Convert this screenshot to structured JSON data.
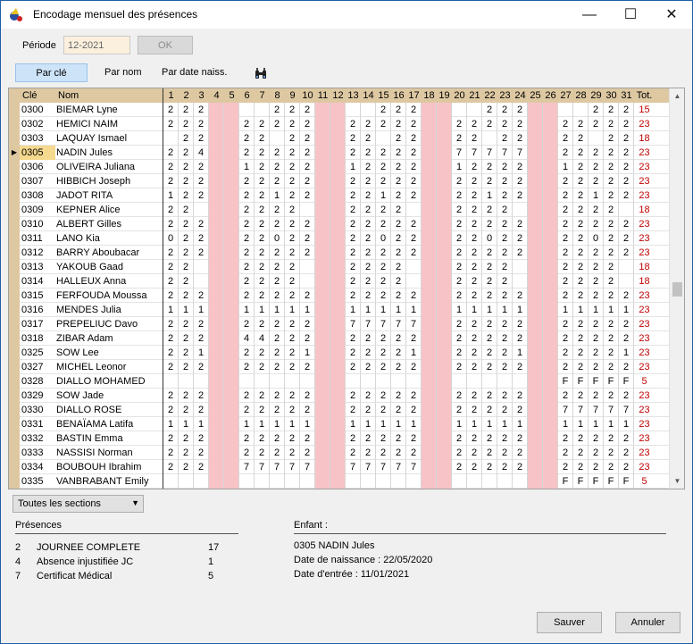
{
  "window": {
    "title": "Encodage mensuel des présences",
    "minimize": "—",
    "maximize": "☐",
    "close": "✕"
  },
  "toolbar": {
    "periode_label": "Période",
    "periode_value": "12-2021",
    "ok_label": "OK",
    "tabs": [
      "Par clé",
      "Par nom",
      "Par date naiss."
    ],
    "search_icon": "binoculars-icon"
  },
  "grid": {
    "col_cle": "Clé",
    "col_nom": "Nom",
    "col_tot": "Tot.",
    "days": [
      "1",
      "2",
      "3",
      "4",
      "5",
      "6",
      "7",
      "8",
      "9",
      "10",
      "11",
      "12",
      "13",
      "14",
      "15",
      "16",
      "17",
      "18",
      "19",
      "20",
      "21",
      "22",
      "23",
      "24",
      "25",
      "26",
      "27",
      "28",
      "29",
      "30",
      "31"
    ],
    "weekend_days": [
      4,
      5,
      11,
      12,
      18,
      19,
      25,
      26
    ],
    "selected_row": 3,
    "rows": [
      {
        "cle": "0300",
        "nom": "BIEMAR Lyne",
        "vals": {
          "1": "2",
          "2": "2",
          "3": "2",
          "8": "2",
          "9": "2",
          "10": "2",
          "15": "2",
          "16": "2",
          "17": "2",
          "22": "2",
          "23": "2",
          "24": "2",
          "29": "2",
          "30": "2",
          "31": "2"
        },
        "tot": "15"
      },
      {
        "cle": "0302",
        "nom": "HEMICI NAIM",
        "vals": {
          "1": "2",
          "2": "2",
          "3": "2",
          "6": "2",
          "7": "2",
          "8": "2",
          "9": "2",
          "10": "2",
          "13": "2",
          "14": "2",
          "15": "2",
          "16": "2",
          "17": "2",
          "20": "2",
          "21": "2",
          "22": "2",
          "23": "2",
          "24": "2",
          "27": "2",
          "28": "2",
          "29": "2",
          "30": "2",
          "31": "2"
        },
        "tot": "23"
      },
      {
        "cle": "0303",
        "nom": "LAQUAY Ismael",
        "vals": {
          "2": "2",
          "3": "2",
          "6": "2",
          "7": "2",
          "9": "2",
          "10": "2",
          "13": "2",
          "14": "2",
          "16": "2",
          "17": "2",
          "20": "2",
          "21": "2",
          "23": "2",
          "24": "2",
          "27": "2",
          "28": "2",
          "30": "2",
          "31": "2"
        },
        "tot": "18"
      },
      {
        "cle": "0305",
        "nom": "NADIN Jules",
        "vals": {
          "1": "2",
          "2": "2",
          "3": "4",
          "6": "2",
          "7": "2",
          "8": "2",
          "9": "2",
          "10": "2",
          "13": "2",
          "14": "2",
          "15": "2",
          "16": "2",
          "17": "2",
          "20": "7",
          "21": "7",
          "22": "7",
          "23": "7",
          "24": "7",
          "27": "2",
          "28": "2",
          "29": "2",
          "30": "2",
          "31": "2"
        },
        "tot": "23"
      },
      {
        "cle": "0306",
        "nom": "OLIVEIRA Juliana",
        "vals": {
          "1": "2",
          "2": "2",
          "3": "2",
          "6": "1",
          "7": "2",
          "8": "2",
          "9": "2",
          "10": "2",
          "13": "1",
          "14": "2",
          "15": "2",
          "16": "2",
          "17": "2",
          "20": "1",
          "21": "2",
          "22": "2",
          "23": "2",
          "24": "2",
          "27": "1",
          "28": "2",
          "29": "2",
          "30": "2",
          "31": "2"
        },
        "tot": "23"
      },
      {
        "cle": "0307",
        "nom": "HIBBICH Joseph",
        "vals": {
          "1": "2",
          "2": "2",
          "3": "2",
          "6": "2",
          "7": "2",
          "8": "2",
          "9": "2",
          "10": "2",
          "13": "2",
          "14": "2",
          "15": "2",
          "16": "2",
          "17": "2",
          "20": "2",
          "21": "2",
          "22": "2",
          "23": "2",
          "24": "2",
          "27": "2",
          "28": "2",
          "29": "2",
          "30": "2",
          "31": "2"
        },
        "tot": "23"
      },
      {
        "cle": "0308",
        "nom": "JADOT RITA",
        "vals": {
          "1": "1",
          "2": "2",
          "3": "2",
          "6": "2",
          "7": "2",
          "8": "1",
          "9": "2",
          "10": "2",
          "13": "2",
          "14": "2",
          "15": "1",
          "16": "2",
          "17": "2",
          "20": "2",
          "21": "2",
          "22": "1",
          "23": "2",
          "24": "2",
          "27": "2",
          "28": "2",
          "29": "1",
          "30": "2",
          "31": "2"
        },
        "tot": "23"
      },
      {
        "cle": "0309",
        "nom": "KEPNER Alice",
        "vals": {
          "1": "2",
          "2": "2",
          "6": "2",
          "7": "2",
          "8": "2",
          "9": "2",
          "13": "2",
          "14": "2",
          "15": "2",
          "16": "2",
          "20": "2",
          "21": "2",
          "22": "2",
          "23": "2",
          "27": "2",
          "28": "2",
          "29": "2",
          "30": "2"
        },
        "tot": "18"
      },
      {
        "cle": "0310",
        "nom": "ALBERT Gilles",
        "vals": {
          "1": "2",
          "2": "2",
          "3": "2",
          "6": "2",
          "7": "2",
          "8": "2",
          "9": "2",
          "10": "2",
          "13": "2",
          "14": "2",
          "15": "2",
          "16": "2",
          "17": "2",
          "20": "2",
          "21": "2",
          "22": "2",
          "23": "2",
          "24": "2",
          "27": "2",
          "28": "2",
          "29": "2",
          "30": "2",
          "31": "2"
        },
        "tot": "23"
      },
      {
        "cle": "0311",
        "nom": "LANO Kia",
        "vals": {
          "1": "0",
          "2": "2",
          "3": "2",
          "6": "2",
          "7": "2",
          "8": "0",
          "9": "2",
          "10": "2",
          "13": "2",
          "14": "2",
          "15": "0",
          "16": "2",
          "17": "2",
          "20": "2",
          "21": "2",
          "22": "0",
          "23": "2",
          "24": "2",
          "27": "2",
          "28": "2",
          "29": "0",
          "30": "2",
          "31": "2"
        },
        "tot": "23"
      },
      {
        "cle": "0312",
        "nom": "BARRY Aboubacar",
        "vals": {
          "1": "2",
          "2": "2",
          "3": "2",
          "6": "2",
          "7": "2",
          "8": "2",
          "9": "2",
          "10": "2",
          "13": "2",
          "14": "2",
          "15": "2",
          "16": "2",
          "17": "2",
          "20": "2",
          "21": "2",
          "22": "2",
          "23": "2",
          "24": "2",
          "27": "2",
          "28": "2",
          "29": "2",
          "30": "2",
          "31": "2"
        },
        "tot": "23"
      },
      {
        "cle": "0313",
        "nom": "YAKOUB Gaad",
        "vals": {
          "1": "2",
          "2": "2",
          "6": "2",
          "7": "2",
          "8": "2",
          "9": "2",
          "13": "2",
          "14": "2",
          "15": "2",
          "16": "2",
          "20": "2",
          "21": "2",
          "22": "2",
          "23": "2",
          "27": "2",
          "28": "2",
          "29": "2",
          "30": "2"
        },
        "tot": "18"
      },
      {
        "cle": "0314",
        "nom": "HALLEUX Anna",
        "vals": {
          "1": "2",
          "2": "2",
          "6": "2",
          "7": "2",
          "8": "2",
          "9": "2",
          "13": "2",
          "14": "2",
          "15": "2",
          "16": "2",
          "20": "2",
          "21": "2",
          "22": "2",
          "23": "2",
          "27": "2",
          "28": "2",
          "29": "2",
          "30": "2"
        },
        "tot": "18"
      },
      {
        "cle": "0315",
        "nom": "FERFOUDA Moussa",
        "vals": {
          "1": "2",
          "2": "2",
          "3": "2",
          "6": "2",
          "7": "2",
          "8": "2",
          "9": "2",
          "10": "2",
          "13": "2",
          "14": "2",
          "15": "2",
          "16": "2",
          "17": "2",
          "20": "2",
          "21": "2",
          "22": "2",
          "23": "2",
          "24": "2",
          "27": "2",
          "28": "2",
          "29": "2",
          "30": "2",
          "31": "2"
        },
        "tot": "23"
      },
      {
        "cle": "0316",
        "nom": "MENDES Julia",
        "vals": {
          "1": "1",
          "2": "1",
          "3": "1",
          "6": "1",
          "7": "1",
          "8": "1",
          "9": "1",
          "10": "1",
          "13": "1",
          "14": "1",
          "15": "1",
          "16": "1",
          "17": "1",
          "20": "1",
          "21": "1",
          "22": "1",
          "23": "1",
          "24": "1",
          "27": "1",
          "28": "1",
          "29": "1",
          "30": "1",
          "31": "1"
        },
        "tot": "23"
      },
      {
        "cle": "0317",
        "nom": "PREPELIUC Davo",
        "vals": {
          "1": "2",
          "2": "2",
          "3": "2",
          "6": "2",
          "7": "2",
          "8": "2",
          "9": "2",
          "10": "2",
          "13": "7",
          "14": "7",
          "15": "7",
          "16": "7",
          "17": "7",
          "20": "2",
          "21": "2",
          "22": "2",
          "23": "2",
          "24": "2",
          "27": "2",
          "28": "2",
          "29": "2",
          "30": "2",
          "31": "2"
        },
        "tot": "23"
      },
      {
        "cle": "0318",
        "nom": "ZIBAR Adam",
        "vals": {
          "1": "2",
          "2": "2",
          "3": "2",
          "6": "4",
          "7": "4",
          "8": "2",
          "9": "2",
          "10": "2",
          "13": "2",
          "14": "2",
          "15": "2",
          "16": "2",
          "17": "2",
          "20": "2",
          "21": "2",
          "22": "2",
          "23": "2",
          "24": "2",
          "27": "2",
          "28": "2",
          "29": "2",
          "30": "2",
          "31": "2"
        },
        "tot": "23"
      },
      {
        "cle": "0325",
        "nom": "SOW Lee",
        "vals": {
          "1": "2",
          "2": "2",
          "3": "1",
          "6": "2",
          "7": "2",
          "8": "2",
          "9": "2",
          "10": "1",
          "13": "2",
          "14": "2",
          "15": "2",
          "16": "2",
          "17": "1",
          "20": "2",
          "21": "2",
          "22": "2",
          "23": "2",
          "24": "1",
          "27": "2",
          "28": "2",
          "29": "2",
          "30": "2",
          "31": "1"
        },
        "tot": "23"
      },
      {
        "cle": "0327",
        "nom": "MICHEL Leonor",
        "vals": {
          "1": "2",
          "2": "2",
          "3": "2",
          "6": "2",
          "7": "2",
          "8": "2",
          "9": "2",
          "10": "2",
          "13": "2",
          "14": "2",
          "15": "2",
          "16": "2",
          "17": "2",
          "20": "2",
          "21": "2",
          "22": "2",
          "23": "2",
          "24": "2",
          "27": "2",
          "28": "2",
          "29": "2",
          "30": "2",
          "31": "2"
        },
        "tot": "23"
      },
      {
        "cle": "0328",
        "nom": "DIALLO MOHAMED",
        "vals": {
          "27": "F",
          "28": "F",
          "29": "F",
          "30": "F",
          "31": "F"
        },
        "tot": "5"
      },
      {
        "cle": "0329",
        "nom": "SOW Jade",
        "vals": {
          "1": "2",
          "2": "2",
          "3": "2",
          "6": "2",
          "7": "2",
          "8": "2",
          "9": "2",
          "10": "2",
          "13": "2",
          "14": "2",
          "15": "2",
          "16": "2",
          "17": "2",
          "20": "2",
          "21": "2",
          "22": "2",
          "23": "2",
          "24": "2",
          "27": "2",
          "28": "2",
          "29": "2",
          "30": "2",
          "31": "2"
        },
        "tot": "23"
      },
      {
        "cle": "0330",
        "nom": "DIALLO ROSE",
        "vals": {
          "1": "2",
          "2": "2",
          "3": "2",
          "6": "2",
          "7": "2",
          "8": "2",
          "9": "2",
          "10": "2",
          "13": "2",
          "14": "2",
          "15": "2",
          "16": "2",
          "17": "2",
          "20": "2",
          "21": "2",
          "22": "2",
          "23": "2",
          "24": "2",
          "27": "7",
          "28": "7",
          "29": "7",
          "30": "7",
          "31": "7"
        },
        "tot": "23"
      },
      {
        "cle": "0331",
        "nom": "BENAÏAMA Latifa",
        "vals": {
          "1": "1",
          "2": "1",
          "3": "1",
          "6": "1",
          "7": "1",
          "8": "1",
          "9": "1",
          "10": "1",
          "13": "1",
          "14": "1",
          "15": "1",
          "16": "1",
          "17": "1",
          "20": "1",
          "21": "1",
          "22": "1",
          "23": "1",
          "24": "1",
          "27": "1",
          "28": "1",
          "29": "1",
          "30": "1",
          "31": "1"
        },
        "tot": "23"
      },
      {
        "cle": "0332",
        "nom": "BASTIN Emma",
        "vals": {
          "1": "2",
          "2": "2",
          "3": "2",
          "6": "2",
          "7": "2",
          "8": "2",
          "9": "2",
          "10": "2",
          "13": "2",
          "14": "2",
          "15": "2",
          "16": "2",
          "17": "2",
          "20": "2",
          "21": "2",
          "22": "2",
          "23": "2",
          "24": "2",
          "27": "2",
          "28": "2",
          "29": "2",
          "30": "2",
          "31": "2"
        },
        "tot": "23"
      },
      {
        "cle": "0333",
        "nom": "NASSISI Norman",
        "vals": {
          "1": "2",
          "2": "2",
          "3": "2",
          "6": "2",
          "7": "2",
          "8": "2",
          "9": "2",
          "10": "2",
          "13": "2",
          "14": "2",
          "15": "2",
          "16": "2",
          "17": "2",
          "20": "2",
          "21": "2",
          "22": "2",
          "23": "2",
          "24": "2",
          "27": "2",
          "28": "2",
          "29": "2",
          "30": "2",
          "31": "2"
        },
        "tot": "23"
      },
      {
        "cle": "0334",
        "nom": "BOUBOUH Ibrahim",
        "vals": {
          "1": "2",
          "2": "2",
          "3": "2",
          "6": "7",
          "7": "7",
          "8": "7",
          "9": "7",
          "10": "7",
          "13": "7",
          "14": "7",
          "15": "7",
          "16": "7",
          "17": "7",
          "20": "2",
          "21": "2",
          "22": "2",
          "23": "2",
          "24": "2",
          "27": "2",
          "28": "2",
          "29": "2",
          "30": "2",
          "31": "2"
        },
        "tot": "23"
      },
      {
        "cle": "0335",
        "nom": "VANBRABANT Emily",
        "vals": {
          "27": "F",
          "28": "F",
          "29": "F",
          "30": "F",
          "31": "F"
        },
        "tot": "5"
      }
    ]
  },
  "sections": {
    "value": "Toutes les sections"
  },
  "presences": {
    "title": "Présences",
    "items": [
      {
        "code": "2",
        "label": "JOURNEE COMPLETE",
        "count": "17"
      },
      {
        "code": "4",
        "label": "Absence injustifiée JC",
        "count": "1"
      },
      {
        "code": "7",
        "label": "Certificat Médical",
        "count": "5"
      }
    ]
  },
  "enfant": {
    "title": "Enfant :",
    "name": "0305 NADIN Jules",
    "birth": "Date de naissance : 22/05/2020",
    "entry": "Date d'entrée : 11/01/2021"
  },
  "buttons": {
    "save": "Sauver",
    "cancel": "Annuler"
  },
  "colors": {
    "header": "#ddc8a2",
    "weekend": "#f7c3c7",
    "total": "#c00000",
    "tab_active": "#cde3f8"
  }
}
